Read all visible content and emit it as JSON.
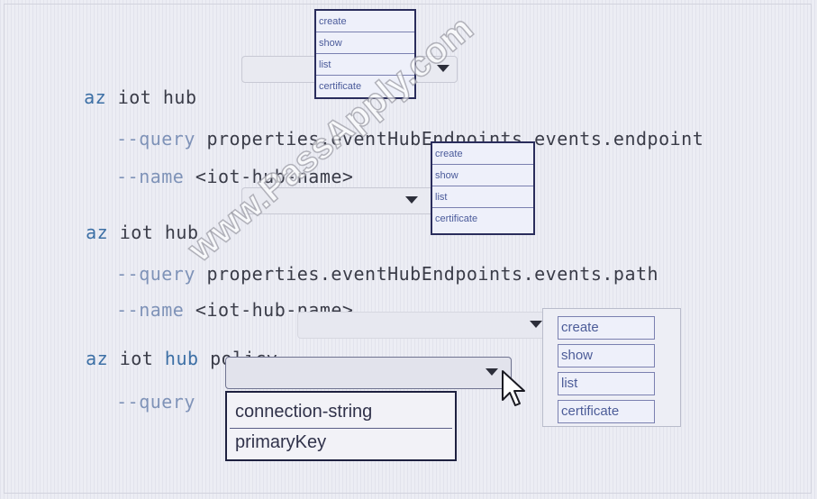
{
  "commands": [
    {
      "az": "az",
      "rest": " iot hub"
    },
    {
      "az": "az",
      "rest": " iot hub"
    },
    {
      "az": "az",
      "mid": " iot ",
      "hub": "hub",
      "tail": " policy"
    }
  ],
  "args": {
    "q1": {
      "dash": "--",
      "key": "query",
      "value": " properties.eventHubEndpoints.events.endpoint"
    },
    "n1": {
      "dash": "--",
      "key": "name",
      "value": " <iot-hub-name>"
    },
    "q2": {
      "dash": "--",
      "key": "query",
      "value": " properties.eventHubEndpoints.events.path"
    },
    "n2": {
      "dash": "--",
      "key": "name",
      "value": " <iot-hub-name>"
    },
    "q3": {
      "dash": "--",
      "key": "query"
    }
  },
  "dropdown1": [
    "create",
    "show",
    "list",
    "certificate"
  ],
  "dropdown2": [
    "create",
    "show",
    "list",
    "certificate"
  ],
  "dropdown3": [
    "create",
    "show",
    "list",
    "certificate"
  ],
  "dropdown4": [
    "connection-string",
    "primaryKey"
  ],
  "watermark": "www.PassApply.com",
  "colors": {
    "keyword": "#3c6fa5",
    "dash": "#7f93b8",
    "dropdown_border": "#2a2d5c"
  }
}
